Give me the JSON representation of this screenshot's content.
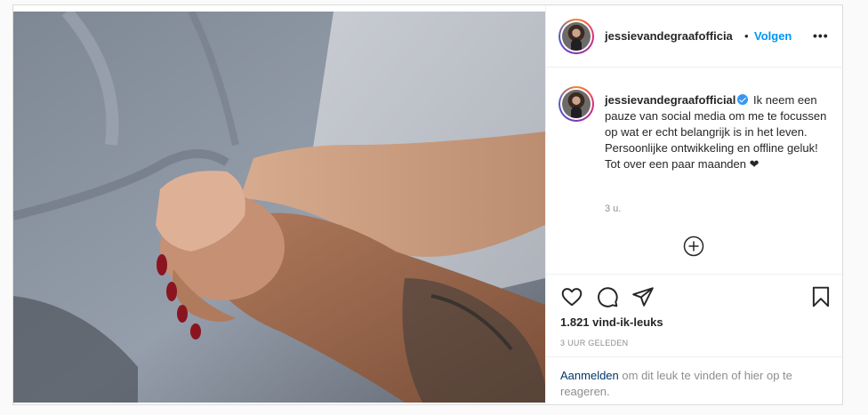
{
  "post": {
    "header": {
      "username": "jessievandegraafofficia",
      "separator": "•",
      "follow_label": "Volgen",
      "more_label": "•••"
    },
    "caption": {
      "username": "jessievandegraafofficial",
      "text": "Ik neem een pauze van social media om me te focussen op wat er echt belangrijk is in het leven. Persoonlijke ontwikkeling en offline geluk! Tot over een paar maanden ❤",
      "time": "3 u."
    },
    "actions": {
      "like_icon": "heart-icon",
      "comment_icon": "comment-icon",
      "share_icon": "share-icon",
      "save_icon": "bookmark-icon"
    },
    "likes": "1.821 vind-ik-leuks",
    "posted_ago": "3 UUR GELEDEN",
    "login": {
      "link_label": "Aanmelden",
      "rest_text": " om dit leuk te vinden of hier op te reageren."
    },
    "image_alt": "Two hands holding on a bed sheet"
  },
  "colors": {
    "accent": "#0095f6",
    "text": "#262626",
    "muted": "#8e8e8e",
    "verified": "#3897f0"
  }
}
